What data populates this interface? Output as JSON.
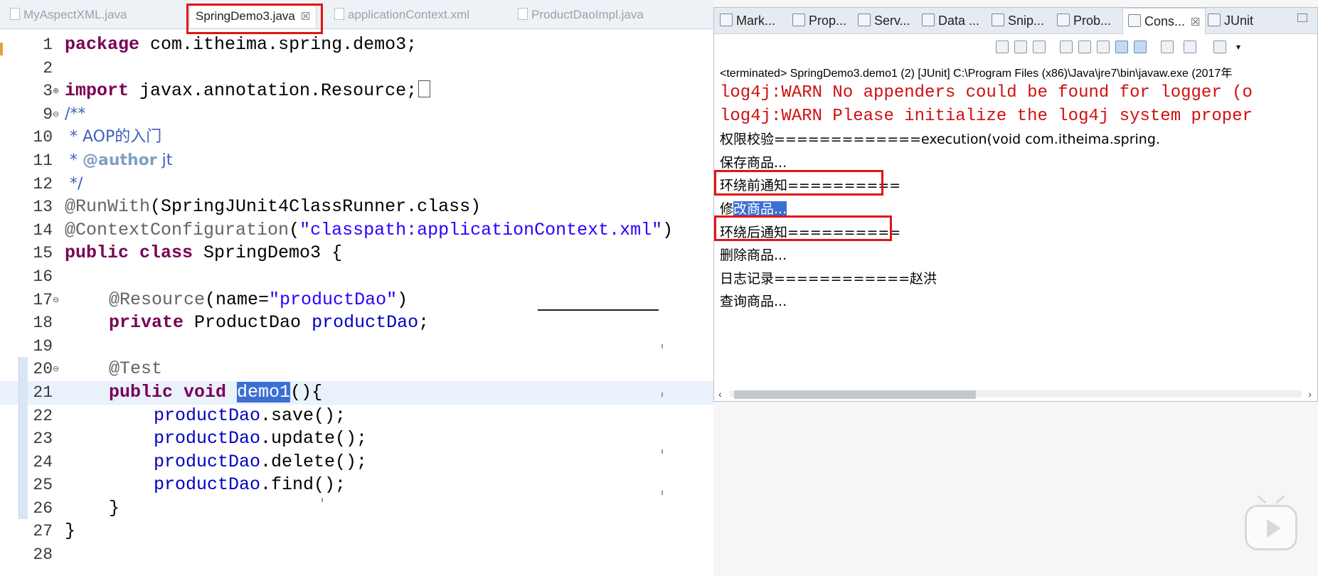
{
  "editor": {
    "tabs": [
      {
        "label": "MyAspectXML.java",
        "active": false
      },
      {
        "label": "SpringDemo3.java",
        "active": true,
        "close": "☒"
      },
      {
        "label": "applicationContext.xml",
        "active": false
      },
      {
        "label": "ProductDaoImpl.java",
        "active": false
      }
    ],
    "line_numbers": [
      "1",
      "2",
      "3",
      "9",
      "10",
      "11",
      "12",
      "13",
      "14",
      "15",
      "16",
      "17",
      "18",
      "19",
      "20",
      "21",
      "22",
      "23",
      "24",
      "25",
      "26",
      "27",
      "28"
    ],
    "code": {
      "l1_kw": "package",
      "l1_rest": " com.itheima.spring.demo3;",
      "l3_kw": "import",
      "l3_rest": " javax.annotation.Resource;",
      "l9": "/**",
      "l10": " * AOP的入门",
      "l11_pre": " * ",
      "l11_tag": "@author",
      "l11_rest": " jt",
      "l12": " */",
      "l13_an": "@RunWith",
      "l13_rest": "(SpringJUnit4ClassRunner.class)",
      "l14_an": "@ContextConfiguration",
      "l14_p": "(",
      "l14_str": "\"classpath:applicationContext.xml\"",
      "l14_e": ")",
      "l15_kw": "public class",
      "l15_rest": " SpringDemo3 {",
      "l17_an": "@Resource",
      "l17_p": "(name=",
      "l17_str": "\"productDao\"",
      "l17_e": ")",
      "l18_kw": "private",
      "l18_type": " ProductDao ",
      "l18_fld": "productDao",
      "l18_e": ";",
      "l20_an": "@Test",
      "l21_kw": "public void",
      "l21_sp": " ",
      "l21_sel": "demo1",
      "l21_rest": "(){",
      "l22_fld": "productDao",
      "l22_rest": ".save();",
      "l23_fld": "productDao",
      "l23_rest": ".update();",
      "l24_fld": "productDao",
      "l24_rest": ".delete();",
      "l25_fld": "productDao",
      "l25_rest": ".find();",
      "l26": "}",
      "l27": "}"
    }
  },
  "views": {
    "tabs": [
      {
        "label": "Mark..."
      },
      {
        "label": "Prop..."
      },
      {
        "label": "Serv..."
      },
      {
        "label": "Data ..."
      },
      {
        "label": "Snip..."
      },
      {
        "label": "Prob..."
      },
      {
        "label": "Cons...",
        "active": true,
        "close": "☒"
      },
      {
        "label": "JUnit"
      }
    ]
  },
  "console": {
    "status": "<terminated> SpringDemo3.demo1 (2) [JUnit] C:\\Program Files (x86)\\Java\\jre7\\bin\\javaw.exe (2017年",
    "lines": [
      "log4j:WARN No appenders could be found for logger (o",
      "log4j:WARN Please initialize the log4j system proper",
      "权限校验=============execution(void com.itheima.spring.",
      "保存商品...",
      "环绕前通知==========",
      "修改商品...",
      "环绕后通知==========",
      "删除商品...",
      "日志记录============赵洪",
      "查询商品..."
    ],
    "sel_prefix": "修",
    "sel_text": "改商品..."
  },
  "scroll_arrows": {
    "left": "‹",
    "right": "›"
  }
}
